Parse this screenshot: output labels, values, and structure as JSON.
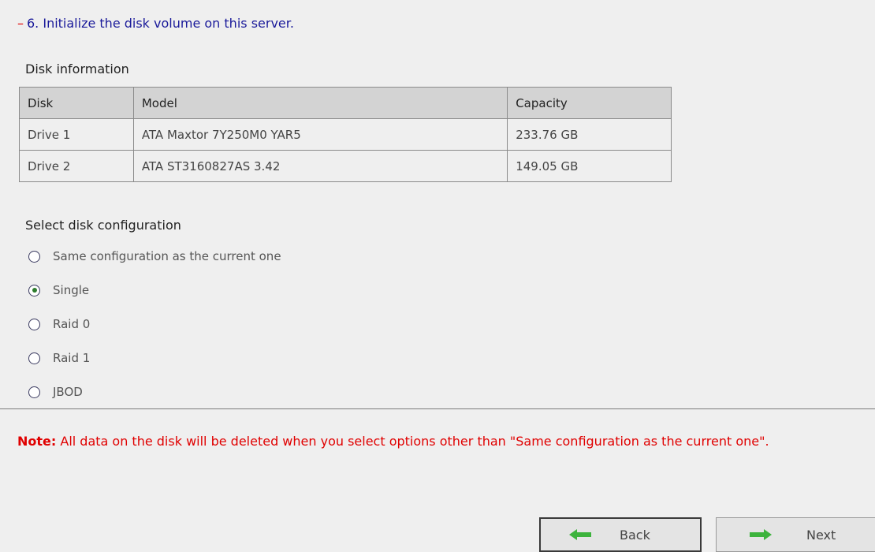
{
  "step": {
    "dash": "–",
    "title": "6. Initialize the disk volume on this server."
  },
  "disk_info": {
    "heading": "Disk information",
    "columns": [
      "Disk",
      "Model",
      "Capacity"
    ],
    "rows": [
      [
        "Drive 1",
        "ATA Maxtor 7Y250M0 YAR5",
        "233.76 GB"
      ],
      [
        "Drive 2",
        "ATA ST3160827AS 3.42",
        "149.05 GB"
      ]
    ]
  },
  "config": {
    "heading": "Select disk configuration",
    "selected": "Single",
    "options": [
      "Same configuration as the current one",
      "Single",
      "Raid 0",
      "Raid 1",
      "JBOD"
    ]
  },
  "note": {
    "label": "Note:",
    "text": " All data on the disk will be deleted when you select options other than \"Same configuration as the current one\"."
  },
  "buttons": {
    "back_label": "Back",
    "next_label": "Next"
  },
  "colors": {
    "title_blue": "#1a1a9a",
    "note_red": "#e00000",
    "arrow_green": "#3cb33c",
    "radio_checked": "#2e7d2e"
  },
  "icons": {
    "back": "arrow-left-icon",
    "next": "arrow-right-icon"
  }
}
